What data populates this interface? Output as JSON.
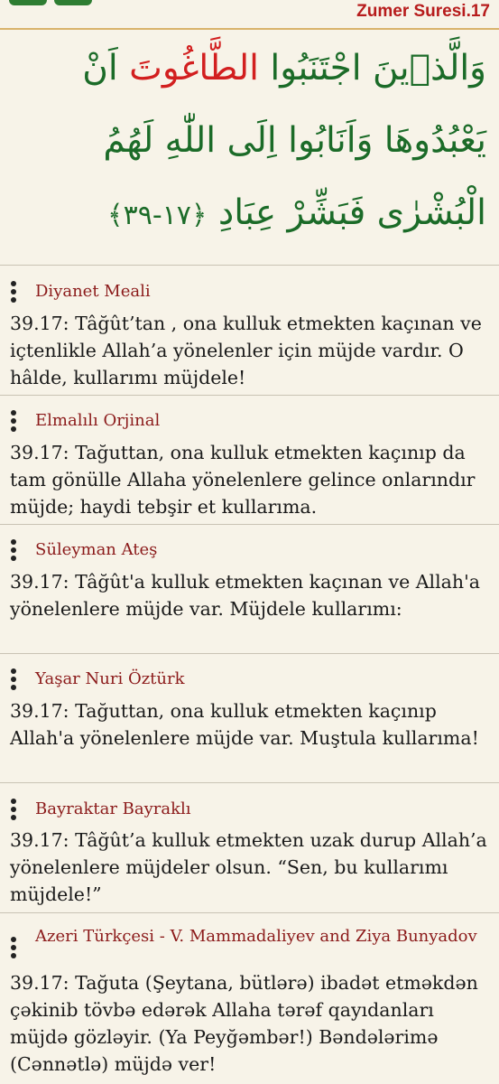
{
  "header": {
    "surah_title": "Zumer Suresi.17"
  },
  "arabic": {
    "part1": "وَالَّذ۪ينَ اجْتَنَبُوا ",
    "highlight": "الطَّاغُوتَ",
    "part2": " اَنْ يَعْبُدُوهَا وَاَنَابُوا اِلَى اللّٰهِ لَهُمُ الْبُشْرٰى فَبَشِّرْ عِبَادِ ",
    "verse_marker": "﴿١٧-٣٩﴾"
  },
  "colors": {
    "arabic_text": "#1b6b28",
    "arabic_highlight": "#d21f1f",
    "author_name": "#8b1a1a",
    "title": "#b71c1c",
    "background": "#f7f3e8"
  },
  "translations": [
    {
      "author": "Diyanet Meali",
      "text": "39.17: Tâğût’tan , ona kulluk etmekten kaçınan ve içtenlikle Allah’a yönelenler  için müjde vardır. O hâlde, kullarımı müjdele!"
    },
    {
      "author": "Elmalılı Orjinal",
      "text": "39.17: Tağuttan, ona kulluk etmekten kaçınıp da tam gönülle Allaha yönelenlere gelince onlarındır müjde; haydi tebşir et kullarıma."
    },
    {
      "author": "Süleyman Ateş",
      "text": "39.17: Tâğût'a kulluk etmekten kaçınan ve Allah'a yönelenlere müjde var. Müjdele kullarımı:"
    },
    {
      "author": "Yaşar Nuri Öztürk",
      "text": "39.17: Tağuttan, ona kulluk etmekten kaçınıp Allah'a yönelenlere müjde var. Muştula kullarıma!"
    },
    {
      "author": "Bayraktar Bayraklı",
      "text": "39.17: Tâğût’a kulluk etmekten uzak durup Allah’a yönelenlere müjdeler olsun. “Sen, bu kullarımı müjdele!”"
    },
    {
      "author": "Azeri Türkçesi - V. Mammadaliyev and Ziya Bunyadov",
      "text": "39.17: Tağuta (Şeytana, bütlərə) ibadət etməkdən çəkinib tövbə edərək Allaha tərəf qayıdanları müjdə gözləyir. (Ya Peyğəmbər!) Bəndələrimə (Cənnətlə) müjdə ver!"
    }
  ]
}
